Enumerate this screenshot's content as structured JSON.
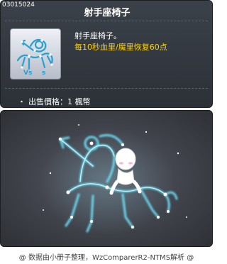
{
  "item": {
    "id": "03015024",
    "name": "射手座椅子",
    "description": "射手座椅子。",
    "effect": "每10秒血里/魔里恢复60点"
  },
  "price": {
    "bullet": "・",
    "text": "出售價格：1 楓幣"
  },
  "footer": {
    "text": "@ 数据由小册子整理，WzComparerR2-NTMS解析 @"
  },
  "colors": {
    "panel_bg": "#33383f",
    "effect_text": "#ffd200",
    "constellation": "#6ee6ff"
  }
}
